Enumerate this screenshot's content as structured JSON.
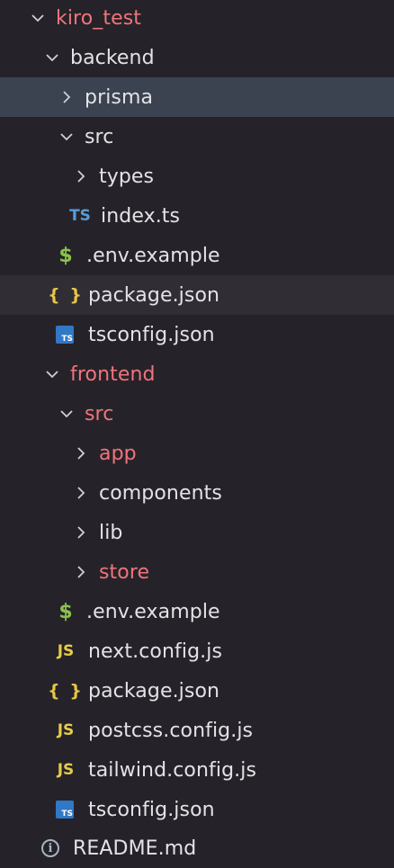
{
  "tree": {
    "root": {
      "label": "kiro_test"
    },
    "backend": {
      "label": "backend"
    },
    "prisma": {
      "label": "prisma"
    },
    "backend_src": {
      "label": "src"
    },
    "types": {
      "label": "types"
    },
    "index_ts": {
      "label": "index.ts",
      "icon": "TS"
    },
    "backend_env": {
      "label": ".env.example",
      "icon": "$"
    },
    "backend_package": {
      "label": "package.json",
      "icon": "{ }"
    },
    "backend_tsconfig": {
      "label": "tsconfig.json",
      "icon": "TS"
    },
    "frontend": {
      "label": "frontend"
    },
    "frontend_src": {
      "label": "src"
    },
    "app": {
      "label": "app"
    },
    "components": {
      "label": "components"
    },
    "lib": {
      "label": "lib"
    },
    "store": {
      "label": "store"
    },
    "frontend_env": {
      "label": ".env.example",
      "icon": "$"
    },
    "next_config": {
      "label": "next.config.js",
      "icon": "JS"
    },
    "frontend_package": {
      "label": "package.json",
      "icon": "{ }"
    },
    "postcss_config": {
      "label": "postcss.config.js",
      "icon": "JS"
    },
    "tailwind_config": {
      "label": "tailwind.config.js",
      "icon": "JS"
    },
    "frontend_tsconfig": {
      "label": "tsconfig.json",
      "icon": "TS"
    },
    "readme": {
      "label": "README.md",
      "icon": "i"
    }
  },
  "colors": {
    "background": "#252329",
    "selected": "#3b4351",
    "hover": "#302d35",
    "text": "#e3e3e6",
    "git_modified": "#f0747c",
    "ts": "#3178c6",
    "js": "#e6cc4a",
    "json": "#e8c547",
    "env": "#8bc34a"
  }
}
